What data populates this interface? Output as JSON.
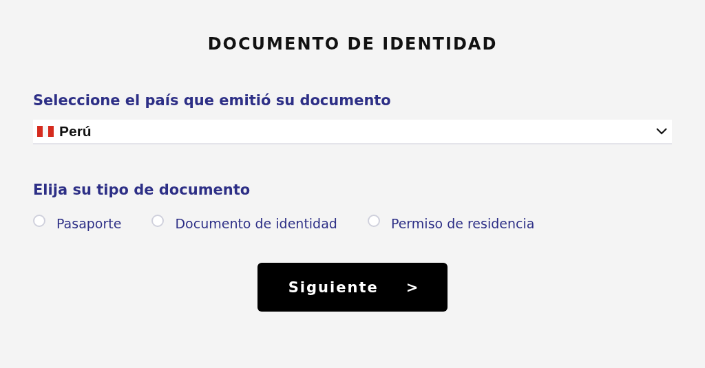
{
  "title": "DOCUMENTO DE IDENTIDAD",
  "country": {
    "label": "Seleccione el país que emitió su documento",
    "value": "Perú"
  },
  "document_type": {
    "label": "Elija su tipo de documento",
    "options": [
      {
        "label": "Pasaporte",
        "selected": false
      },
      {
        "label": "Documento de identidad",
        "selected": false
      },
      {
        "label": "Permiso de residencia",
        "selected": false
      }
    ]
  },
  "next_button": {
    "label": "Siguiente",
    "arrow": ">"
  }
}
